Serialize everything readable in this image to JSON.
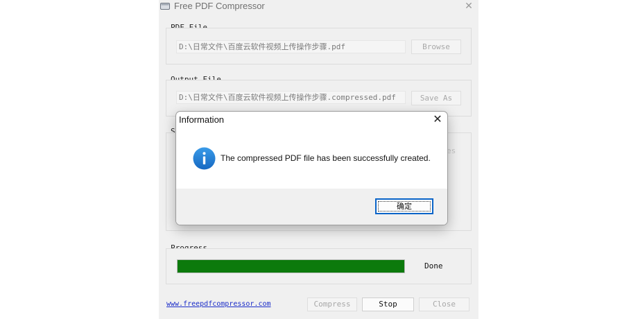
{
  "window": {
    "title": "Free PDF Compressor",
    "close_symbol": "✕"
  },
  "pdf_file": {
    "label": "PDF File",
    "path": "D:\\日常文件\\百度云软件视频上传操作步骤.pdf",
    "browse_label": "Browse"
  },
  "output_file": {
    "label": "Output File",
    "path": "D:\\日常文件\\百度云软件视频上传操作步骤.compressed.pdf",
    "save_as_label": "Save As"
  },
  "settings": {
    "label_partial": "S",
    "right_partial": "es"
  },
  "progress": {
    "label": "Progress",
    "value_percent": 100,
    "status": "Done"
  },
  "footer": {
    "link_text": "www.freepdfcompressor.com",
    "compress_label": "Compress",
    "stop_label": "Stop",
    "close_label": "Close"
  },
  "dialog": {
    "title": "Information",
    "close_symbol": "✕",
    "message": "The compressed PDF file has been successfully created.",
    "ok_label": "确定",
    "icon": "info-icon"
  },
  "colors": {
    "progress_fill": "#0c7a0c",
    "info_icon": "#1e7fd6",
    "ok_border": "#0a64c8",
    "link": "#1a2cc8"
  }
}
